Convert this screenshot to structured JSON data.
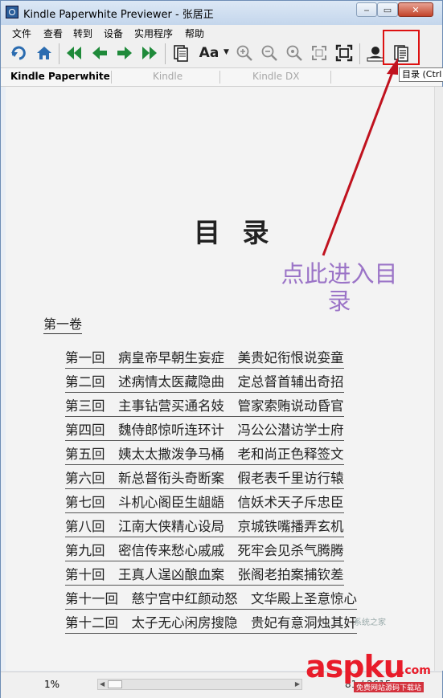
{
  "window": {
    "title": "Kindle Paperwhite Previewer - 张居正",
    "min_glyph": "‒",
    "max_glyph": "▭",
    "close_glyph": "✕"
  },
  "menu": {
    "items": [
      "文件",
      "查看",
      "转到",
      "设备",
      "实用程序",
      "帮助"
    ]
  },
  "toolbar": {
    "font_label": "Aa",
    "font_caret": "▼",
    "buttons": [
      {
        "icon": "rotate-icon"
      },
      {
        "icon": "home-icon"
      },
      {
        "icon": "first-page-icon"
      },
      {
        "icon": "prev-page-icon"
      },
      {
        "icon": "next-page-icon"
      },
      {
        "icon": "last-page-icon"
      },
      {
        "icon": "page-view-icon"
      },
      {
        "icon": "font-size-icon"
      },
      {
        "icon": "zoom-in-icon"
      },
      {
        "icon": "zoom-out-icon"
      },
      {
        "icon": "zoom-reset-icon"
      },
      {
        "icon": "fit-page-icon"
      },
      {
        "icon": "fullscreen-icon"
      },
      {
        "icon": "user-icon"
      },
      {
        "icon": "toc-icon"
      }
    ],
    "tooltip": "目录 (Ctrl"
  },
  "devices": {
    "tabs": [
      "Kindle Paperwhite",
      "Kindle",
      "Kindle DX"
    ],
    "active": "Kindle Paperwhite"
  },
  "content": {
    "toc_title": "目 录",
    "annotation": "点此进入目录",
    "volume_title": "第一卷",
    "chapters": [
      "第一回　病皇帝早朝生妄症　美贵妃衔恨说娈童",
      "第二回　述病情太医藏隐曲　定总督首辅出奇招",
      "第三回　主事钻营买通名妓　管家索贿说动昏官",
      "第四回　魏侍郎惊听连环计　冯公公潜访学士府",
      "第五回　姨太太撒泼争马桶　老和尚正色释签文",
      "第六回　新总督衔头奇断案　假老表千里访行辕",
      "第七回　斗机心阁臣生龃龉　信妖术天子斥忠臣",
      "第八回　江南大侠精心设局　京城铁嘴播弄玄机",
      "第九回　密信传来愁心戚戚　死牢会见杀气腾腾",
      "第十回　王真人逞凶酿血案　张阁老拍案捕钦差",
      "第十一回　慈宁宫中红颜动怒　文华殿上圣意惊心",
      "第十二回　太子无心闲房搜隐　贵妃有意洞烛其奸"
    ]
  },
  "status": {
    "progress": "1%",
    "page_count": "81 / 2615",
    "scroll_left": "◀",
    "scroll_right": "▶"
  },
  "watermark": {
    "asp": "asp",
    "ku": "ku",
    "com": ".com",
    "sub": "免费网站源码下载站",
    "logo": "系统之家"
  },
  "colors": {
    "annotation": "#9b74c7",
    "highlight": "#dd1111",
    "watermark": "#e81c2a",
    "nav_arrows": "#1f8a3a",
    "home": "#2b6cb0"
  }
}
